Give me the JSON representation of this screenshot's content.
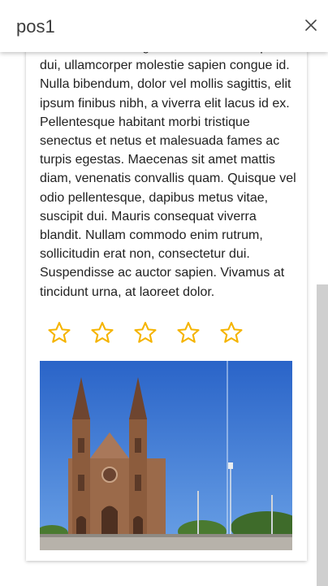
{
  "header": {
    "title": "pos1",
    "close_icon": "close-icon"
  },
  "card": {
    "description": "mi et facilisis. Integer vestibulum suscipit dui, ullamcorper molestie sapien congue id. Nulla bibendum, dolor vel mollis sagittis, elit ipsum finibus nibh, a viverra elit lacus id ex. Pellentesque habitant morbi tristique senectus et netus et malesuada fames ac turpis egestas. Maecenas sit amet mattis diam, venenatis convallis quam. Quisque vel odio pellentesque, dapibus metus vitae, suscipit dui. Mauris consequat viverra blandit. Nullam commodo enim rutrum, sollicitudin erat non, consectetur dui. Suspendisse ac auctor sapien. Vivamus at tincidunt urna, at laoreet dolor.",
    "rating": {
      "max": 5,
      "value": 0,
      "star_color": "#f5b400"
    },
    "image": {
      "subject": "cathedral-photo"
    }
  },
  "colors": {
    "scrollbar": "#cfcfcf",
    "sky": "#2f6fd3"
  }
}
